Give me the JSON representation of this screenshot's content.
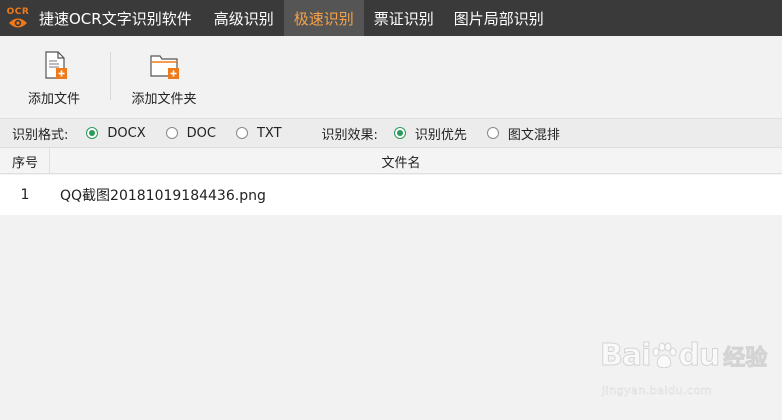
{
  "titlebar": {
    "logo_text": "OCR",
    "app_name": "捷速OCR文字识别软件",
    "tabs": [
      {
        "label": "高级识别",
        "active": false
      },
      {
        "label": "极速识别",
        "active": true
      },
      {
        "label": "票证识别",
        "active": false
      },
      {
        "label": "图片局部识别",
        "active": false
      }
    ]
  },
  "toolbar": {
    "add_file_label": "添加文件",
    "add_folder_label": "添加文件夹"
  },
  "options": {
    "format_label": "识别格式:",
    "formats": [
      {
        "label": "DOCX",
        "checked": true
      },
      {
        "label": "DOC",
        "checked": false
      },
      {
        "label": "TXT",
        "checked": false
      }
    ],
    "effect_label": "识别效果:",
    "effects": [
      {
        "label": "识别优先",
        "checked": true
      },
      {
        "label": "图文混排",
        "checked": false
      }
    ]
  },
  "table": {
    "col_index": "序号",
    "col_filename": "文件名",
    "rows": [
      {
        "index": "1",
        "filename": "QQ截图20181019184436.png"
      }
    ]
  },
  "watermark": {
    "brand": "Bai",
    "brand_suffix": "du",
    "product": "经验",
    "url": "jingyan.baidu.com"
  },
  "colors": {
    "titlebar_bg": "#3a3a3a",
    "active_tab_text": "#f5a04a",
    "accent_orange": "#f07a1a",
    "radio_checked": "#2a9a5a"
  }
}
